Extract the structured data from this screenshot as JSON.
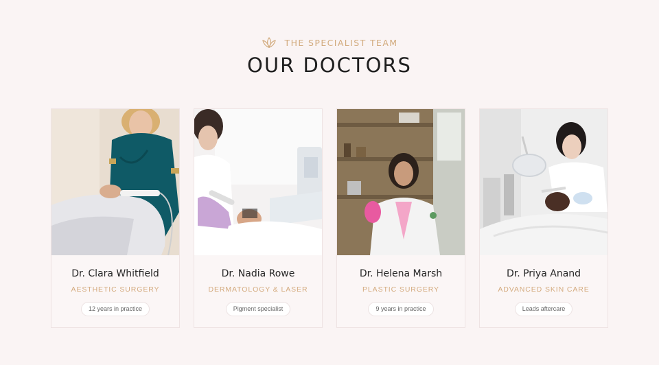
{
  "section": {
    "eyebrow": "THE SPECIALIST TEAM",
    "title": "OUR DOCTORS",
    "accent_color": "#d2ab7e"
  },
  "doctors": [
    {
      "name": "Dr. Clara Whitfield",
      "specialty": "AESTHETIC SURGERY",
      "badge": "12 years in practice"
    },
    {
      "name": "Dr. Nadia Rowe",
      "specialty": "DERMATOLOGY & LASER",
      "badge": "Pigment specialist"
    },
    {
      "name": "Dr. Helena Marsh",
      "specialty": "PLASTIC SURGERY",
      "badge": "9 years in practice"
    },
    {
      "name": "Dr. Priya Anand",
      "specialty": "ADVANCED SKIN CARE",
      "badge": "Leads aftercare"
    }
  ]
}
